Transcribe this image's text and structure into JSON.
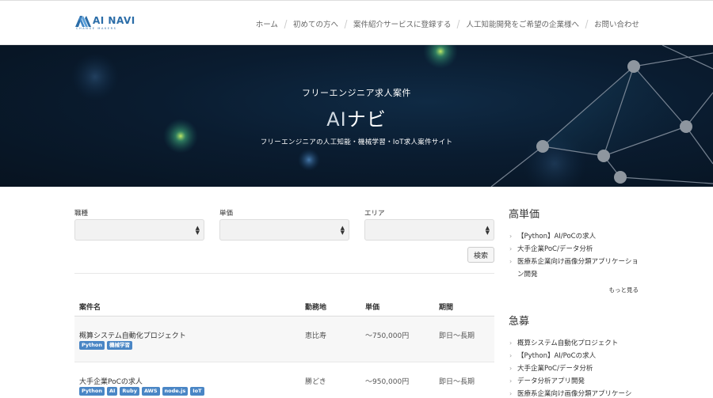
{
  "brand": {
    "name": "AI NAVI",
    "tagline": "CHANGE MAKERS",
    "color": "#2b6da8"
  },
  "nav": {
    "items": [
      {
        "label": "ホーム"
      },
      {
        "label": "初めての方へ"
      },
      {
        "label": "案件紹介サービスに登録する"
      },
      {
        "label": "人工知能開発をご希望の企業様へ"
      },
      {
        "label": "お問い合わせ"
      }
    ]
  },
  "hero": {
    "subtitle": "フリーエンジニア求人案件",
    "title_ai": "AI",
    "title_rest": "ナビ",
    "description": "フリーエンジニアの人工知能・機械学習・IoT求人案件サイト"
  },
  "search": {
    "fields": [
      {
        "label": "職種",
        "value": ""
      },
      {
        "label": "単価",
        "value": ""
      },
      {
        "label": "エリア",
        "value": ""
      }
    ],
    "button_label": "検索"
  },
  "table": {
    "headers": {
      "name": "案件名",
      "location": "勤務地",
      "price": "単価",
      "period": "期間"
    },
    "rows": [
      {
        "name": "概算システム自動化プロジェクト",
        "tags": [
          "Python",
          "機械学習"
        ],
        "location": "恵比寿",
        "price": "〜750,000円",
        "period": "即日〜長期"
      },
      {
        "name": "大手企業PoCの求人",
        "tags": [
          "Python",
          "AI",
          "Ruby",
          "AWS",
          "node.js",
          "IoT"
        ],
        "location": "勝どき",
        "price": "〜950,000円",
        "period": "即日〜長期"
      }
    ],
    "tag_color": "#4a86c5"
  },
  "sidebar": {
    "high_price": {
      "heading": "高単価",
      "items": [
        "【Python】AI/PoCの求人",
        "大手企業PoC/データ分析",
        "医療系企業向け画像分類アプリケーション開発"
      ],
      "more_label": "もっと見る"
    },
    "urgent": {
      "heading": "急募",
      "items": [
        "概算システム自動化プロジェクト",
        "【Python】AI/PoCの求人",
        "大手企業PoC/データ分析",
        "データ分析アプリ開発",
        "医療系企業向け画像分類アプリケーシ"
      ]
    }
  }
}
